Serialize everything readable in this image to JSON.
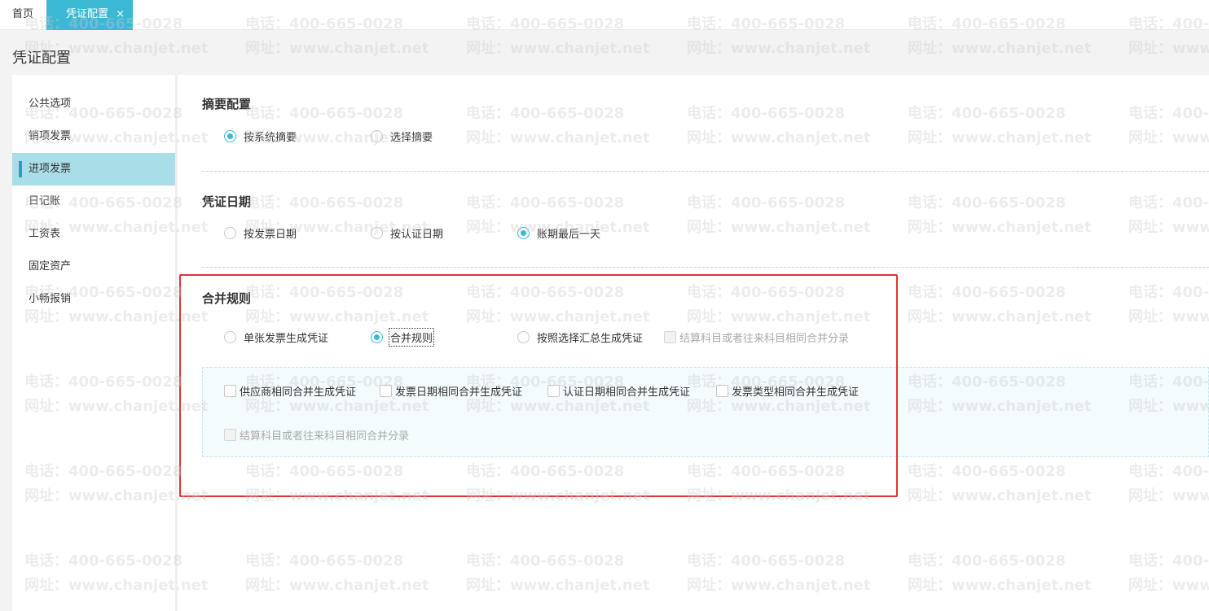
{
  "tabs": {
    "home": "首页",
    "active": "凭证配置",
    "close_glyph": "×"
  },
  "page_title": "凭证配置",
  "sidebar": {
    "items": [
      {
        "label": "公共选项",
        "active": false
      },
      {
        "label": "销项发票",
        "active": false
      },
      {
        "label": "进项发票",
        "active": true
      },
      {
        "label": "日记账",
        "active": false
      },
      {
        "label": "工资表",
        "active": false
      },
      {
        "label": "固定资产",
        "active": false
      },
      {
        "label": "小畅报销",
        "active": false
      }
    ]
  },
  "summary_config": {
    "title": "摘要配置",
    "options": [
      {
        "label": "按系统摘要",
        "checked": true
      },
      {
        "label": "选择摘要",
        "checked": false
      }
    ]
  },
  "voucher_date": {
    "title": "凭证日期",
    "options": [
      {
        "label": "按发票日期",
        "checked": false
      },
      {
        "label": "按认证日期",
        "checked": false
      },
      {
        "label": "账期最后一天",
        "checked": true
      }
    ]
  },
  "merge_rules": {
    "title": "合并规则",
    "options": [
      {
        "label": "单张发票生成凭证",
        "checked": false
      },
      {
        "label": "合并规则",
        "checked": true
      },
      {
        "label": "按照选择汇总生成凭证",
        "checked": false
      }
    ],
    "top_disabled_checkbox": {
      "label": "结算科目或者往来科目相同合并分录",
      "checked": false,
      "disabled": true
    },
    "sub_checkboxes": [
      {
        "label": "供应商相同合并生成凭证",
        "checked": false
      },
      {
        "label": "发票日期相同合并生成凭证",
        "checked": false
      },
      {
        "label": "认证日期相同合并生成凭证",
        "checked": false
      },
      {
        "label": "发票类型相同合并生成凭证",
        "checked": false
      }
    ],
    "sub_disabled_checkbox": {
      "label": "结算科目或者往来科目相同合并分录",
      "checked": false,
      "disabled": true
    }
  },
  "watermark": {
    "phone": "电话：400-665-0028",
    "site": "网址：www.chanjet.net"
  },
  "colors": {
    "accent": "#3bb8d4",
    "sidebar_active_bg": "#a9dde8",
    "highlight_border": "#e53232"
  }
}
